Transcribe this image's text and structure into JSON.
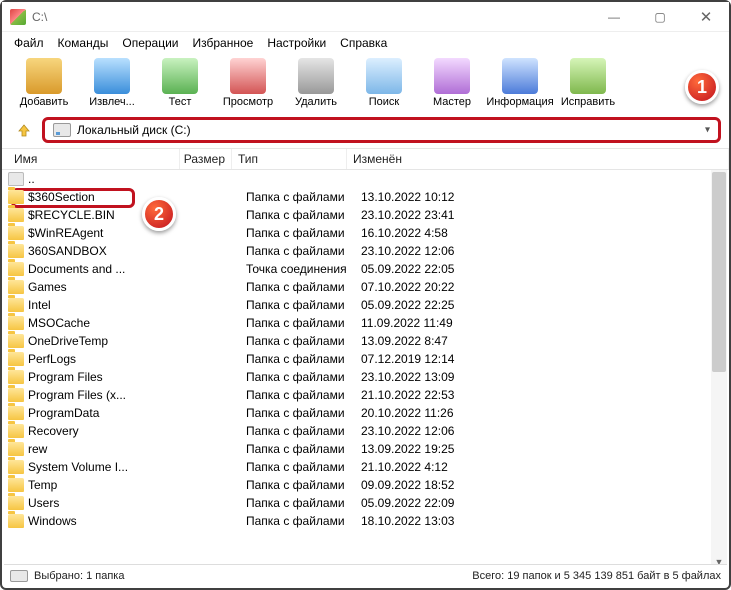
{
  "title": "C:\\",
  "menu": [
    "Файл",
    "Команды",
    "Операции",
    "Избранное",
    "Настройки",
    "Справка"
  ],
  "toolbar": [
    {
      "label": "Добавить",
      "cls": "ic-add",
      "name": "add-button"
    },
    {
      "label": "Извлеч...",
      "cls": "ic-ext",
      "name": "extract-button"
    },
    {
      "label": "Тест",
      "cls": "ic-test",
      "name": "test-button"
    },
    {
      "label": "Просмотр",
      "cls": "ic-view",
      "name": "view-button"
    },
    {
      "label": "Удалить",
      "cls": "ic-del",
      "name": "delete-button"
    },
    {
      "label": "Поиск",
      "cls": "ic-find",
      "name": "find-button"
    },
    {
      "label": "Мастер",
      "cls": "ic-wiz",
      "name": "wizard-button"
    },
    {
      "label": "Информация",
      "cls": "ic-info",
      "name": "info-button"
    },
    {
      "label": "Исправить",
      "cls": "ic-fix",
      "name": "repair-button"
    }
  ],
  "address": "Локальный диск (C:)",
  "columns": {
    "name": "Имя",
    "size": "Размер",
    "type": "Тип",
    "modified": "Изменён"
  },
  "rows": [
    {
      "name": "..",
      "type": "",
      "mod": "",
      "up": true
    },
    {
      "name": "$360Section",
      "type": "Папка с файлами",
      "mod": "13.10.2022 10:12"
    },
    {
      "name": "$RECYCLE.BIN",
      "type": "Папка с файлами",
      "mod": "23.10.2022 23:41"
    },
    {
      "name": "$WinREAgent",
      "type": "Папка с файлами",
      "mod": "16.10.2022 4:58"
    },
    {
      "name": "360SANDBOX",
      "type": "Папка с файлами",
      "mod": "23.10.2022 12:06"
    },
    {
      "name": "Documents and ...",
      "type": "Точка соединения",
      "mod": "05.09.2022 22:05"
    },
    {
      "name": "Games",
      "type": "Папка с файлами",
      "mod": "07.10.2022 20:22"
    },
    {
      "name": "Intel",
      "type": "Папка с файлами",
      "mod": "05.09.2022 22:25"
    },
    {
      "name": "MSOCache",
      "type": "Папка с файлами",
      "mod": "11.09.2022 11:49"
    },
    {
      "name": "OneDriveTemp",
      "type": "Папка с файлами",
      "mod": "13.09.2022 8:47"
    },
    {
      "name": "PerfLogs",
      "type": "Папка с файлами",
      "mod": "07.12.2019 12:14"
    },
    {
      "name": "Program Files",
      "type": "Папка с файлами",
      "mod": "23.10.2022 13:09"
    },
    {
      "name": "Program Files (x...",
      "type": "Папка с файлами",
      "mod": "21.10.2022 22:53"
    },
    {
      "name": "ProgramData",
      "type": "Папка с файлами",
      "mod": "20.10.2022 11:26"
    },
    {
      "name": "Recovery",
      "type": "Папка с файлами",
      "mod": "23.10.2022 12:06"
    },
    {
      "name": "rew",
      "type": "Папка с файлами",
      "mod": "13.09.2022 19:25"
    },
    {
      "name": "System Volume I...",
      "type": "Папка с файлами",
      "mod": "21.10.2022 4:12"
    },
    {
      "name": "Temp",
      "type": "Папка с файлами",
      "mod": "09.09.2022 18:52"
    },
    {
      "name": "Users",
      "type": "Папка с файлами",
      "mod": "05.09.2022 22:09"
    },
    {
      "name": "Windows",
      "type": "Папка с файлами",
      "mod": "18.10.2022 13:03"
    }
  ],
  "status": {
    "left": "Выбрано: 1 папка",
    "right": "Всего: 19 папок и 5 345 139 851 байт в 5 файлах"
  },
  "badges": {
    "one": "1",
    "two": "2"
  }
}
